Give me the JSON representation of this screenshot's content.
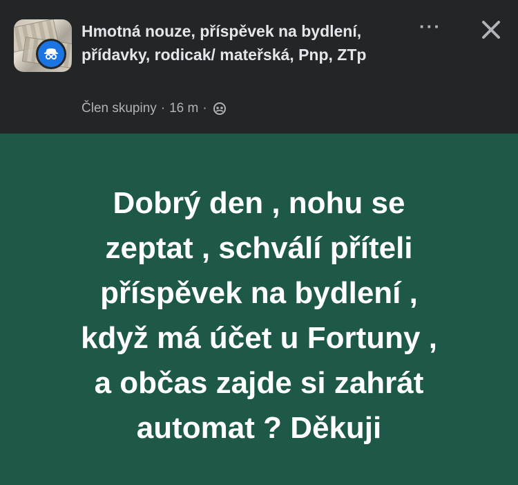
{
  "header": {
    "group_name": "Hmotná nouze, příspěvek na bydlení, přídavky, rodicak/ mateřská, Pnp, ZTp",
    "author_role": "Člen skupiny",
    "separator": "·",
    "time_ago": "16 m",
    "audience_icon": "group-audience-icon",
    "more_label": "···",
    "close_icon": "close-icon"
  },
  "post": {
    "background_color": "#1e5848",
    "text_color": "#ffffff",
    "lines": [
      "Dobrý den , nohu se",
      "zeptat , schválí příteli",
      "příspěvek na bydlení ,",
      "když má účet u Fortuny ,",
      "a občas zajde si zahrát",
      "automat ? Děkuji"
    ]
  }
}
